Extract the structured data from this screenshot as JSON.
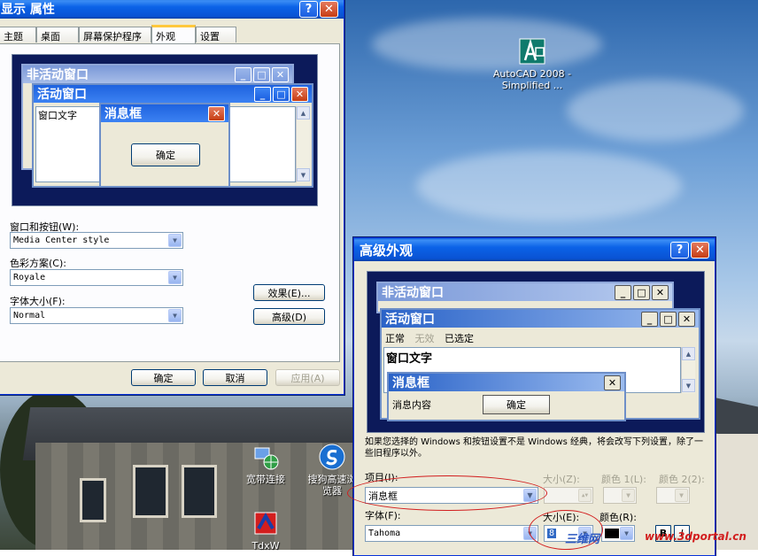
{
  "display_props": {
    "title": "显示 属性",
    "title_visible": "显示 属性",
    "tabs": [
      "主题",
      "桌面",
      "屏幕保护程序",
      "外观",
      "设置"
    ],
    "active_tab": "外观",
    "preview": {
      "inactive_title": "非活动窗口",
      "active_title": "活动窗口",
      "window_text": "窗口文字",
      "msgbox_title": "消息框",
      "ok": "确定"
    },
    "windows_buttons_label": "窗口和按钮(W):",
    "windows_buttons_value": "Media Center style",
    "color_scheme_label": "色彩方案(C):",
    "color_scheme_value": "Royale",
    "font_size_label": "字体大小(F):",
    "font_size_value": "Normal",
    "effects_button": "效果(E)...",
    "advanced_button": "高级(D)",
    "ok": "确定",
    "cancel": "取消",
    "apply": "应用(A)"
  },
  "advanced": {
    "title": "高级外观",
    "preview": {
      "inactive_title": "非活动窗口",
      "active_title": "活动窗口",
      "menu": [
        "正常",
        "无效",
        "已选定"
      ],
      "window_text": "窗口文字",
      "msgbox_title": "消息框",
      "msg_text": "消息内容",
      "ok": "确定"
    },
    "note": "如果您选择的 Windows 和按钮设置不是 Windows 经典，将会改写下列设置，除了一些旧程序以外。",
    "item_label": "项目(I):",
    "item_value": "消息框",
    "size_label": "大小(Z):",
    "color1_label": "颜色 1(L):",
    "color2_label": "颜色 2(2):",
    "font_label": "字体(F):",
    "font_value": "Tahoma",
    "font_size_label": "大小(E):",
    "font_size_value": "8",
    "font_color_label": "颜色(R):",
    "bold_label": "B",
    "italic_label": "I"
  },
  "desktop": {
    "icons": [
      {
        "name": "AutoCAD 2008 - Simplified ..."
      },
      {
        "name": "宽带连接"
      },
      {
        "name": "搜狗高速浏览器"
      },
      {
        "name": "TdxW"
      }
    ],
    "watermark_cn": "三维网",
    "watermark_url": "www.3dportal.cn"
  },
  "colors": {
    "title_blue": "#0b62e7",
    "preview_navy": "#0c1a5a",
    "highlight_red": "#d21e1e"
  }
}
